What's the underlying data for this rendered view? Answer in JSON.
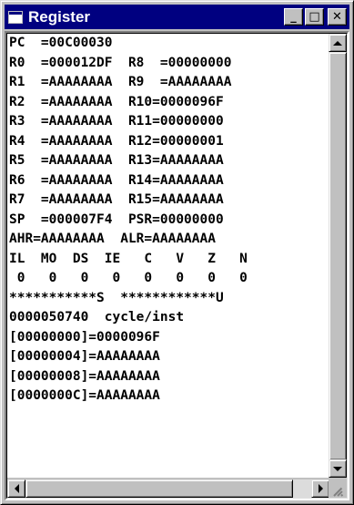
{
  "window": {
    "title": "Register",
    "icon": "window-app-icon"
  },
  "titlebar_buttons": [
    {
      "name": "minimize-button",
      "glyph": "_"
    },
    {
      "name": "maximize-button",
      "glyph": "□"
    },
    {
      "name": "close-button",
      "glyph": "✕"
    }
  ],
  "lines": [
    "PC  =00C00030",
    "R0  =000012DF  R8  =00000000",
    "R1  =AAAAAAAA  R9  =AAAAAAAA",
    "R2  =AAAAAAAA  R10=0000096F",
    "R3  =AAAAAAAA  R11=00000000",
    "R4  =AAAAAAAA  R12=00000001",
    "R5  =AAAAAAAA  R13=AAAAAAAA",
    "R6  =AAAAAAAA  R14=AAAAAAAA",
    "R7  =AAAAAAAA  R15=AAAAAAAA",
    "SP  =000007F4  PSR=00000000",
    "AHR=AAAAAAAA  ALR=AAAAAAAA",
    "IL  MO  DS  IE   C   V   Z   N",
    " 0   0   0   0   0   0   0   0",
    "***********S  ************U",
    "0000050740  cycle/inst",
    "[00000000]=0000096F",
    "[00000004]=AAAAAAAA",
    "[00000008]=AAAAAAAA",
    "[0000000C]=AAAAAAAA"
  ],
  "colors": {
    "titlebar": "#000080",
    "face": "#c0c0c0",
    "content_bg": "#ffffff"
  }
}
